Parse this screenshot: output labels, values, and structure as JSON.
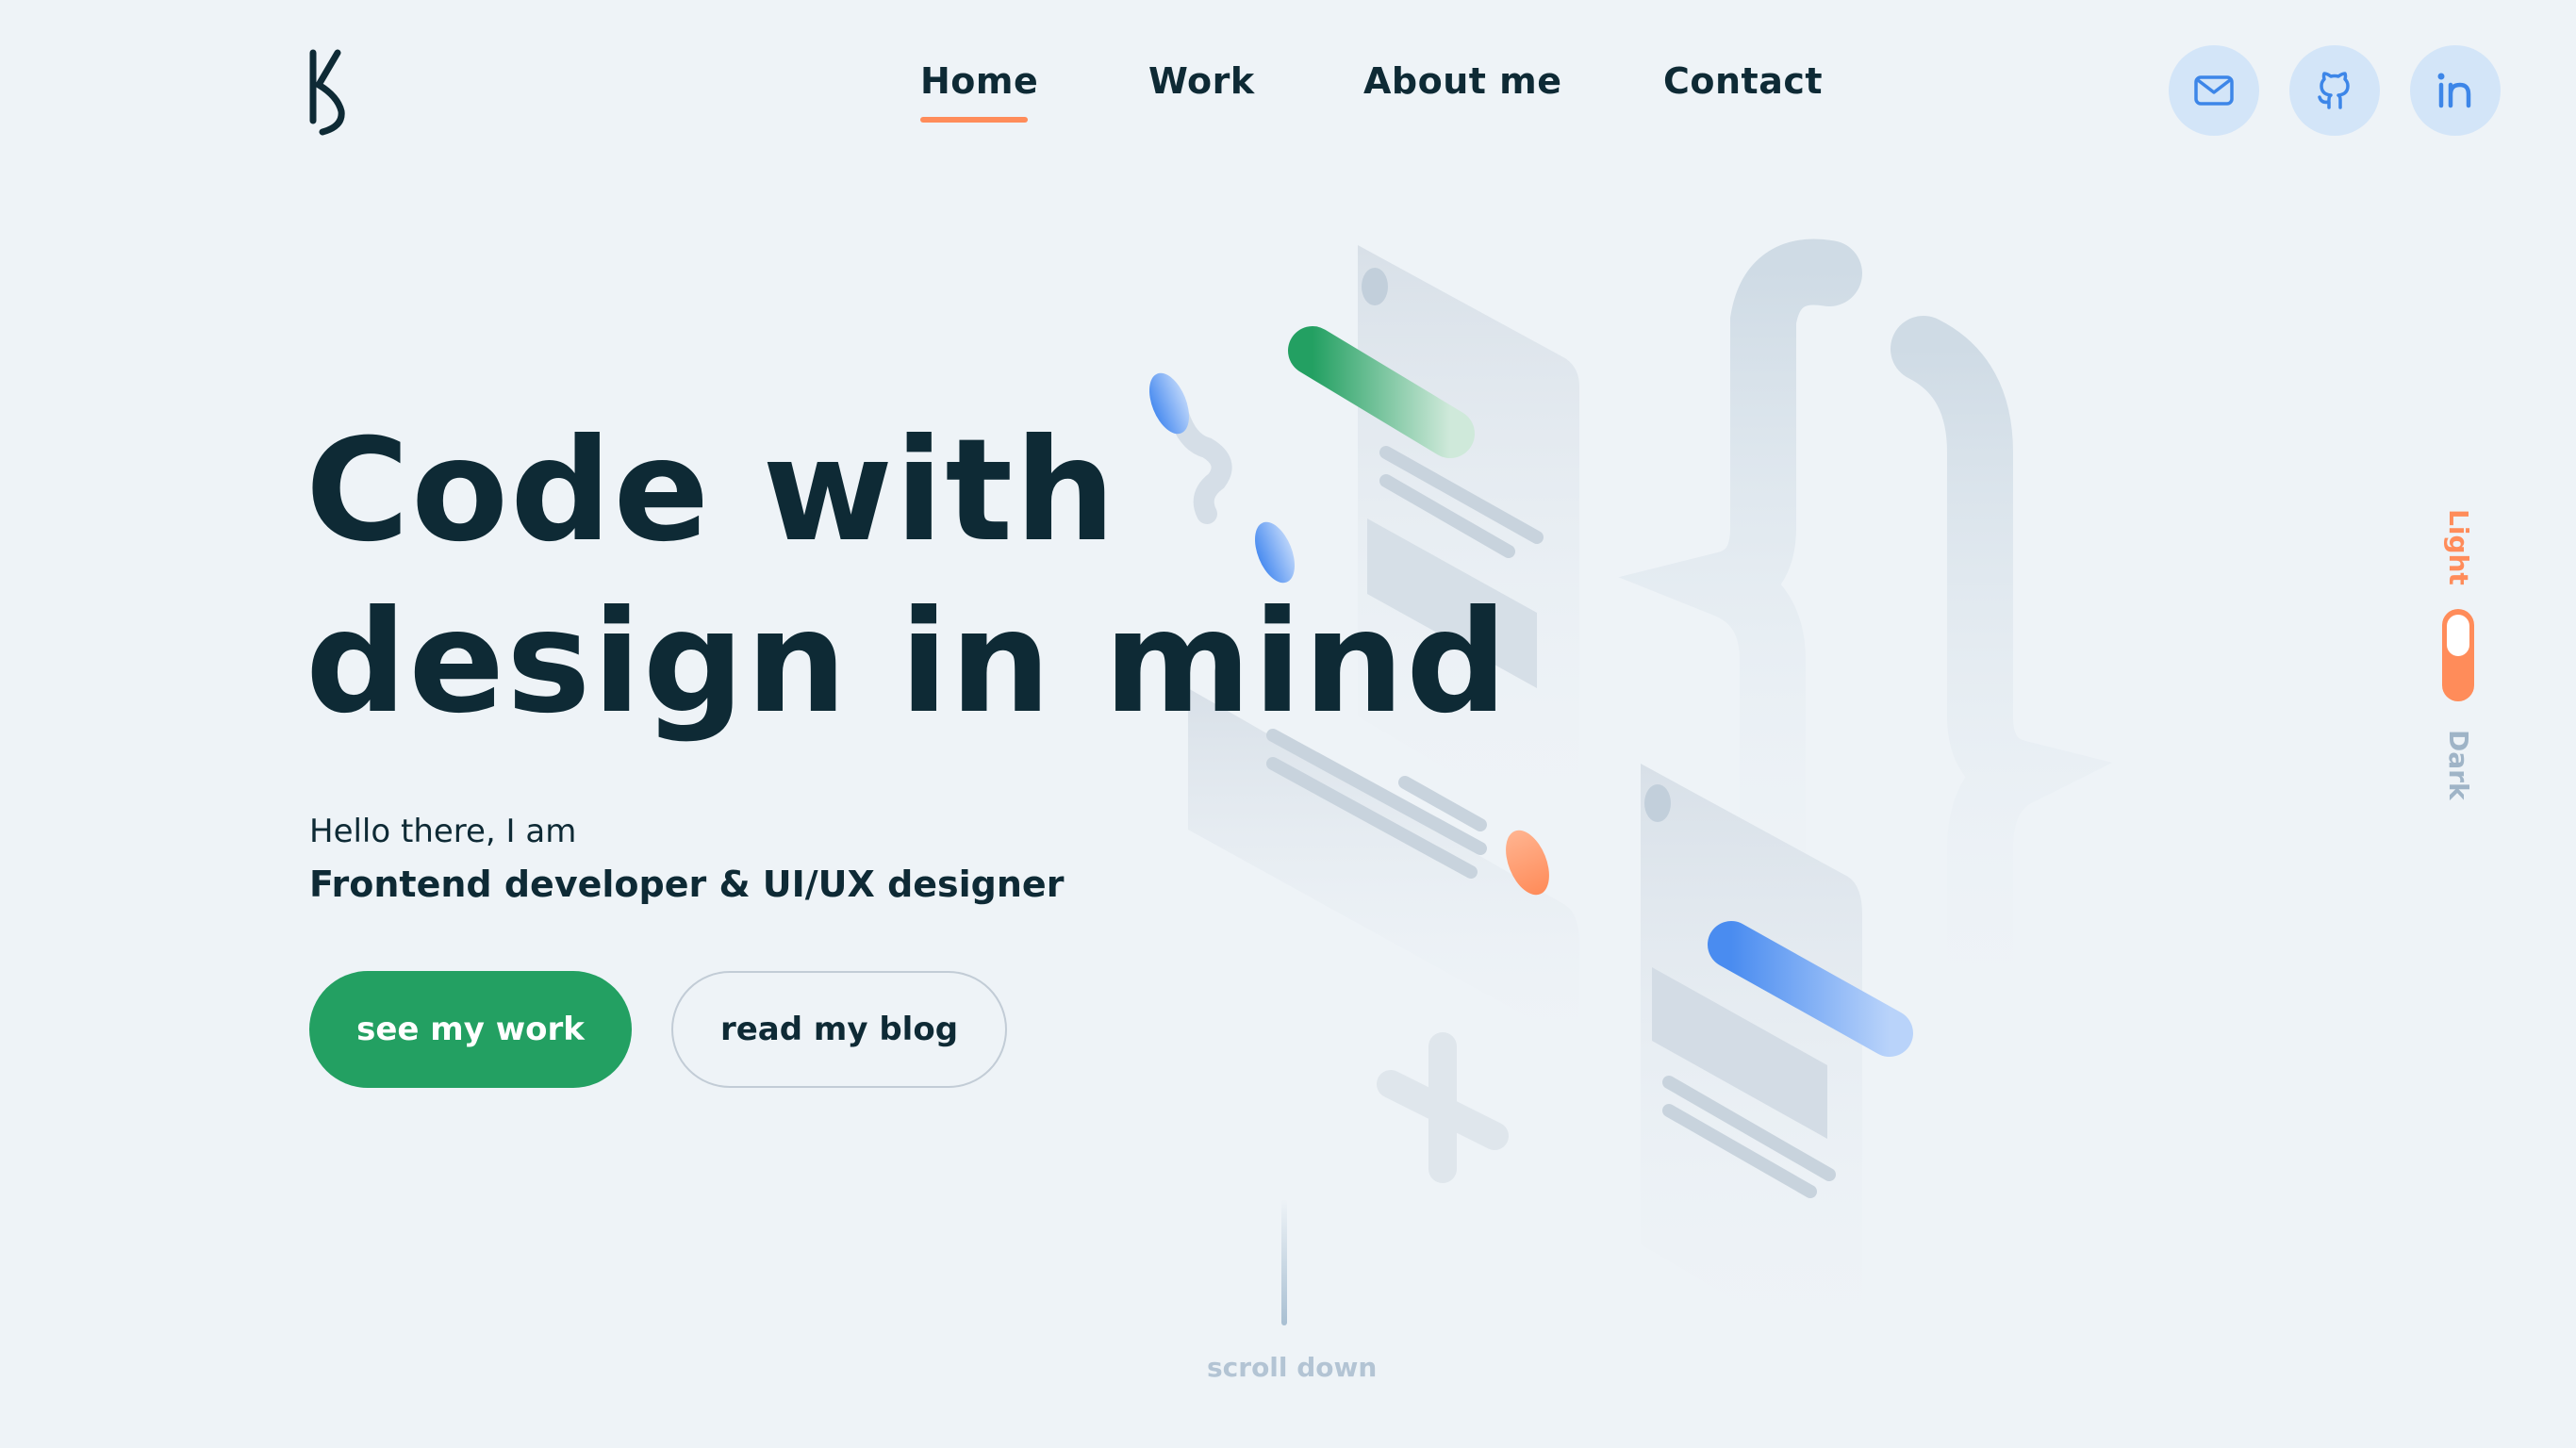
{
  "brand": {
    "logo_letter": "KS"
  },
  "nav": {
    "items": [
      {
        "label": "Home",
        "active": true
      },
      {
        "label": "Work",
        "active": false
      },
      {
        "label": "About me",
        "active": false
      },
      {
        "label": "Contact",
        "active": false
      }
    ]
  },
  "social": [
    {
      "icon": "mail-icon"
    },
    {
      "icon": "github-icon"
    },
    {
      "icon": "linkedin-icon"
    }
  ],
  "hero": {
    "headline_line1": "Code with",
    "headline_line2": "design in mind",
    "greeting": "Hello there, I am",
    "role": "Frontend developer & UI/UX designer",
    "primary_button": "see my work",
    "secondary_button": "read my blog"
  },
  "scroll": {
    "label": "scroll down"
  },
  "theme_toggle": {
    "light_label": "Light",
    "dark_label": "Dark",
    "current": "Light"
  },
  "colors": {
    "background": "#eef3f7",
    "text": "#0e2a35",
    "accent_orange": "#ff8c5a",
    "primary_green": "#23a062",
    "icon_blue": "#3d86e8",
    "icon_bg": "#d3e5f8"
  }
}
